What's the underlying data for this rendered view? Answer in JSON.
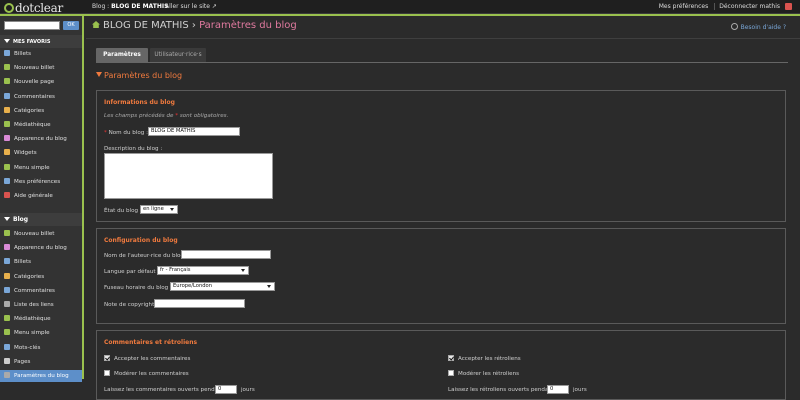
{
  "topbar": {
    "logo": "dotclear",
    "blog_prefix": "Blog : ",
    "blog_name": "BLOG DE MATHIS",
    "visit_site": "Aller sur le site",
    "preferences": "Mes préférences",
    "logout": "Déconnecter mathis"
  },
  "sidebar": {
    "search_placeholder": "",
    "ok_label": "OK",
    "favorites_title": "Mes favoris",
    "favorites": [
      {
        "label": "Billets",
        "color": "#7aa7d8"
      },
      {
        "label": "Nouveau billet",
        "color": "#9ac14e"
      },
      {
        "label": "Nouvelle page",
        "color": "#9ac14e"
      },
      {
        "label": "Commentaires",
        "color": "#7aa7d8"
      },
      {
        "label": "Catégories",
        "color": "#e8b04c"
      },
      {
        "label": "Médiathèque",
        "color": "#9ac14e"
      },
      {
        "label": "Apparence du blog",
        "color": "#d98ad6"
      },
      {
        "label": "Widgets",
        "color": "#e8b04c"
      },
      {
        "label": "Menu simple",
        "color": "#9ac14e"
      },
      {
        "label": "Mes préférences",
        "color": "#7aa7d8"
      },
      {
        "label": "Aide générale",
        "color": "#d9534f"
      }
    ],
    "blog_title": "Blog",
    "blog_items": [
      {
        "label": "Nouveau billet",
        "color": "#9ac14e"
      },
      {
        "label": "Apparence du blog",
        "color": "#d98ad6"
      },
      {
        "label": "Billets",
        "color": "#7aa7d8"
      },
      {
        "label": "Catégories",
        "color": "#e8b04c"
      },
      {
        "label": "Commentaires",
        "color": "#7aa7d8"
      },
      {
        "label": "Liste des liens",
        "color": "#aaaaaa"
      },
      {
        "label": "Médiathèque",
        "color": "#9ac14e"
      },
      {
        "label": "Menu simple",
        "color": "#9ac14e"
      },
      {
        "label": "Mots-clés",
        "color": "#7aa7d8"
      },
      {
        "label": "Pages",
        "color": "#cccccc"
      },
      {
        "label": "Paramètres du blog",
        "color": "#aaaaaa"
      }
    ]
  },
  "main": {
    "breadcrumb_blog": "BLOG DE MATHIS",
    "breadcrumb_sep": " › ",
    "breadcrumb_page": "Paramètres du blog",
    "help": "Besoin d'aide ?",
    "tabs": [
      "Paramètres",
      "Utilisateur·rice·s"
    ],
    "heading": "Paramètres du blog",
    "info": {
      "legend": "Informations du blog",
      "required_note_pre": "Les champs précédés de ",
      "required_note_star": "*",
      "required_note_post": " sont obligatoires.",
      "name_label": " Nom du blog :",
      "name_value": "BLOG DE MATHIS",
      "description_label": "Description du blog :",
      "status_label": "État du blog :",
      "status_value": "en ligne"
    },
    "config": {
      "legend": "Configuration du blog",
      "author_label": "Nom de l'auteur·rice du blog :",
      "author_value": "",
      "lang_label": "Langue par défaut :",
      "lang_value": "fr - Français",
      "tz_label": "Fuseau horaire du blog :",
      "tz_value": "Europe/London",
      "copyright_label": "Note de copyright :",
      "copyright_value": ""
    },
    "comments": {
      "legend": "Commentaires et rétroliens",
      "accept_comments": "Accepter les commentaires",
      "moderate_comments": "Modérer les commentaires",
      "open_comments_pre": "Laissez les commentaires ouverts pendant",
      "open_comments_value": "0",
      "open_comments_post": "jours",
      "accept_trackbacks": "Accepter les rétroliens",
      "moderate_trackbacks": "Modérer les rétroliens",
      "open_trackbacks_pre": "Laissez les rétroliens ouverts pendant",
      "open_trackbacks_value": "0",
      "open_trackbacks_post": "jours"
    }
  }
}
